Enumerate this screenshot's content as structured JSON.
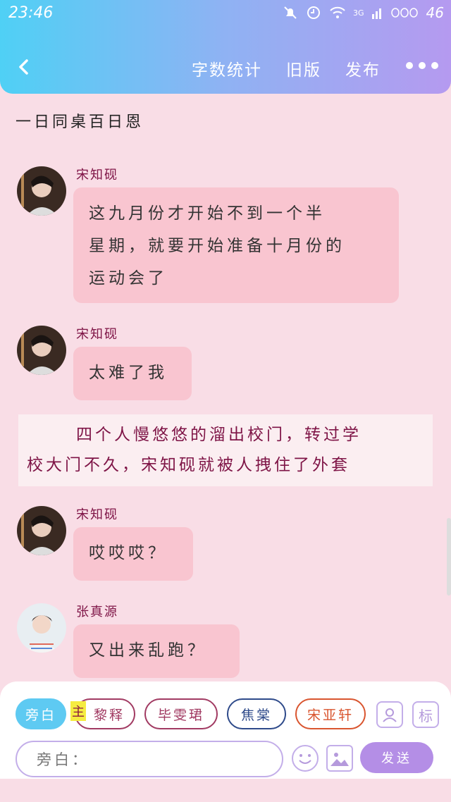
{
  "status_bar": {
    "time": "23:46",
    "battery": "46",
    "network": "3G"
  },
  "nav": {
    "word_count": "字数统计",
    "old_version": "旧版",
    "publish": "发布"
  },
  "story": {
    "title": "一日同桌百日恩"
  },
  "messages": [
    {
      "name": "宋知砚",
      "lines": [
        "这九月份才开始不到一个半",
        "星期，就要开始准备十月份的",
        "运动会了"
      ]
    },
    {
      "name": "宋知砚",
      "lines": [
        "太难了我"
      ]
    },
    {
      "name": "宋知砚",
      "lines": [
        "哎哎哎？"
      ]
    },
    {
      "name": "张真源",
      "lines": [
        "又出来乱跑？"
      ]
    }
  ],
  "narration": {
    "line1": "四个人慢悠悠的溜出校门，转过学",
    "line2": "校大门不久，宋知砚就被人拽住了外套"
  },
  "composer": {
    "chip_narration": "旁白",
    "main_badge": "主",
    "chip_a": "黎释",
    "chip_b": "毕雯珺",
    "chip_c": "焦棠",
    "chip_d": "宋亚轩",
    "tag_icon": "标",
    "input_placeholder": "旁白：",
    "send_label": "发送"
  },
  "colors": {
    "accent_cyan": "#5ecaf2",
    "accent_purple": "#b48ee6",
    "bubble": "#f9c5d0",
    "name": "#7e1446"
  }
}
